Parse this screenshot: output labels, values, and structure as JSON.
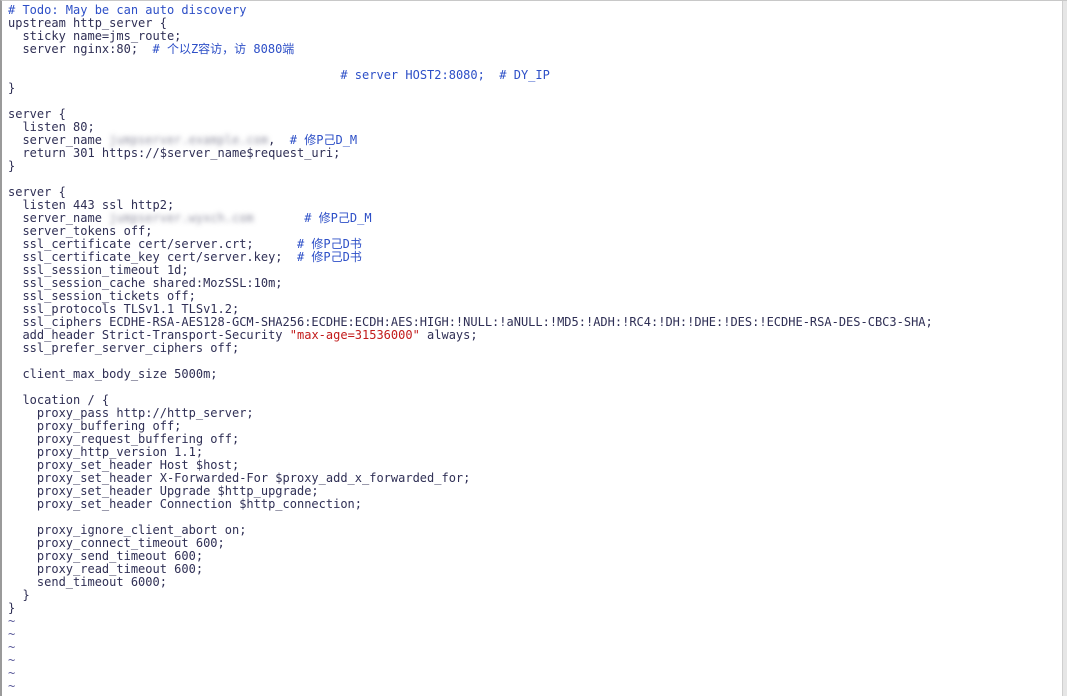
{
  "editor": {
    "colors": {
      "text": "#2f2f55",
      "comment": "#2d4fc7",
      "string": "#c21a1a",
      "tilde": "#5a5a9a"
    },
    "lines": [
      [
        {
          "t": "# Todo: May be can auto discovery",
          "c": "comment"
        }
      ],
      [
        {
          "t": "upstream http_server {"
        }
      ],
      [
        {
          "t": "  sticky name=jms_route;"
        }
      ],
      [
        {
          "t": "  server nginx:80;  "
        },
        {
          "t": "# 个以Z容访，访 8080端",
          "c": "comment"
        }
      ],
      [
        {
          "t": ""
        }
      ],
      [
        {
          "t": "                                              "
        },
        {
          "t": "# server HOST2:8080;  # DY_IP",
          "c": "comment"
        }
      ],
      [
        {
          "t": "}"
        }
      ],
      [
        {
          "t": ""
        }
      ],
      [
        {
          "t": "server {"
        }
      ],
      [
        {
          "t": "  listen 80;"
        }
      ],
      [
        {
          "t": "  server_name "
        },
        {
          "t": "jumpserver.example.com",
          "c": "blur"
        },
        {
          "t": ",  "
        },
        {
          "t": "# 修P己D_M",
          "c": "comment"
        }
      ],
      [
        {
          "t": "  return 301 https://$server_name$request_uri;"
        }
      ],
      [
        {
          "t": "}"
        }
      ],
      [
        {
          "t": ""
        }
      ],
      [
        {
          "t": "server {"
        }
      ],
      [
        {
          "t": "  listen 443 ssl http2;"
        }
      ],
      [
        {
          "t": "  server_name "
        },
        {
          "t": "jumpserver.wyxch.com",
          "c": "blur"
        },
        {
          "t": "       "
        },
        {
          "t": "# 修P己D_M",
          "c": "comment"
        }
      ],
      [
        {
          "t": "  server_tokens off;"
        }
      ],
      [
        {
          "t": "  ssl_certificate cert/server.crt;      "
        },
        {
          "t": "# 修P己D书",
          "c": "comment"
        }
      ],
      [
        {
          "t": "  ssl_certificate_key cert/server.key;  "
        },
        {
          "t": "# 修P己D书",
          "c": "comment"
        }
      ],
      [
        {
          "t": "  ssl_session_timeout 1d;"
        }
      ],
      [
        {
          "t": "  ssl_session_cache shared:MozSSL:10m;"
        }
      ],
      [
        {
          "t": "  ssl_session_tickets off;"
        }
      ],
      [
        {
          "t": "  ssl_protocols TLSv1.1 TLSv1.2;"
        }
      ],
      [
        {
          "t": "  ssl_ciphers ECDHE-RSA-AES128-GCM-SHA256:ECDHE:ECDH:AES:HIGH:!NULL:!aNULL:!MD5:!ADH:!RC4:!DH:!DHE:!DES:!ECDHE-RSA-DES-CBC3-SHA;"
        }
      ],
      [
        {
          "t": "  add_header Strict-Transport-Security "
        },
        {
          "t": "\"max-age=31536000\"",
          "c": "str"
        },
        {
          "t": " always;"
        }
      ],
      [
        {
          "t": "  ssl_prefer_server_ciphers off;"
        }
      ],
      [
        {
          "t": ""
        }
      ],
      [
        {
          "t": "  client_max_body_size 5000m;"
        }
      ],
      [
        {
          "t": ""
        }
      ],
      [
        {
          "t": "  location / {"
        }
      ],
      [
        {
          "t": "    proxy_pass http://http_server;"
        }
      ],
      [
        {
          "t": "    proxy_buffering off;"
        }
      ],
      [
        {
          "t": "    proxy_request_buffering off;"
        }
      ],
      [
        {
          "t": "    proxy_http_version 1.1;"
        }
      ],
      [
        {
          "t": "    proxy_set_header Host $host;"
        }
      ],
      [
        {
          "t": "    proxy_set_header X-Forwarded-For $proxy_add_x_forwarded_for;"
        }
      ],
      [
        {
          "t": "    proxy_set_header Upgrade $http_upgrade;"
        }
      ],
      [
        {
          "t": "    proxy_set_header Connection $http_connection;"
        }
      ],
      [
        {
          "t": ""
        }
      ],
      [
        {
          "t": "    proxy_ignore_client_abort on;"
        }
      ],
      [
        {
          "t": "    proxy_connect_timeout 600;"
        }
      ],
      [
        {
          "t": "    proxy_send_timeout 600;"
        }
      ],
      [
        {
          "t": "    proxy_read_timeout 600;"
        }
      ],
      [
        {
          "t": "    send_timeout 6000;"
        }
      ],
      [
        {
          "t": "  }"
        }
      ],
      [
        {
          "t": "}"
        }
      ],
      [
        {
          "t": "~",
          "c": "tilde"
        }
      ],
      [
        {
          "t": "~",
          "c": "tilde"
        }
      ],
      [
        {
          "t": "~",
          "c": "tilde"
        }
      ],
      [
        {
          "t": "~",
          "c": "tilde"
        }
      ],
      [
        {
          "t": "~",
          "c": "tilde"
        }
      ],
      [
        {
          "t": "~",
          "c": "tilde"
        }
      ]
    ]
  }
}
